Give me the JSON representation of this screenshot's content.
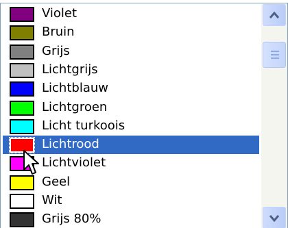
{
  "list": {
    "items": [
      {
        "label": "Violet",
        "color": "#800080",
        "selected": false
      },
      {
        "label": "Bruin",
        "color": "#808000",
        "selected": false
      },
      {
        "label": "Grijs",
        "color": "#808080",
        "selected": false
      },
      {
        "label": "Lichtgrijs",
        "color": "#c0c0c0",
        "selected": false
      },
      {
        "label": "Lichtblauw",
        "color": "#0000ff",
        "selected": false
      },
      {
        "label": "Lichtgroen",
        "color": "#00ff00",
        "selected": false
      },
      {
        "label": "Licht turkoois",
        "color": "#00ffff",
        "selected": false
      },
      {
        "label": "Lichtrood",
        "color": "#ff0000",
        "selected": true
      },
      {
        "label": "Lichtviolet",
        "color": "#ff00ff",
        "selected": false
      },
      {
        "label": "Geel",
        "color": "#ffff00",
        "selected": false
      },
      {
        "label": "Wit",
        "color": "#ffffff",
        "selected": false
      },
      {
        "label": "Grijs 80%",
        "color": "#333333",
        "selected": false
      }
    ]
  },
  "colors": {
    "selection": "#316ac5",
    "border": "#7f9db9"
  },
  "icons": {
    "scroll_up": "chevron-up-icon",
    "scroll_down": "chevron-down-icon",
    "thumb_grip": "grip-icon",
    "cursor": "mouse-pointer-icon"
  }
}
